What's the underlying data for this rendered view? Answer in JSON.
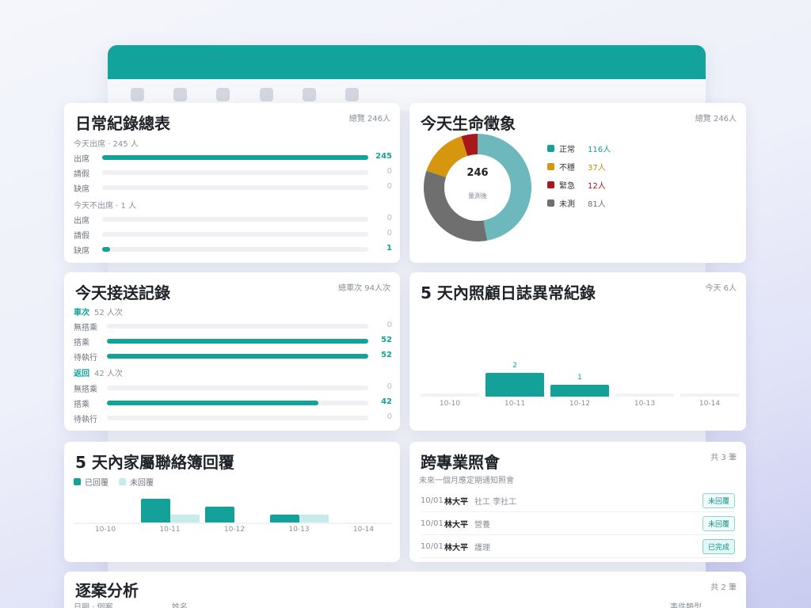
{
  "daily": {
    "title": "日常紀錄總表",
    "meta": "總覽 246人",
    "present_head": "今天出席 · 245 人",
    "present_rows": [
      {
        "label": "出席",
        "value": "245",
        "pct": 1.0
      },
      {
        "label": "請假",
        "value": "0",
        "pct": 0
      },
      {
        "label": "缺席",
        "value": "0",
        "pct": 0
      }
    ],
    "absent_head": "今天不出席 · 1 人",
    "absent_rows": [
      {
        "label": "出席",
        "value": "0",
        "pct": 0
      },
      {
        "label": "請假",
        "value": "0",
        "pct": 0
      },
      {
        "label": "缺席",
        "value": "1",
        "pct": 0.03
      }
    ]
  },
  "vitals": {
    "title": "今天生命徵象",
    "meta": "總覽 246人",
    "center_value": "246",
    "center_label": "量測後",
    "legend": [
      {
        "name": "正常",
        "value": "116人",
        "count": 116,
        "color": "#6cb8bd"
      },
      {
        "name": "不穩",
        "value": "37人",
        "count": 37,
        "color": "#d6960d"
      },
      {
        "name": "緊急",
        "value": "12人",
        "count": 12,
        "color": "#a8171a"
      },
      {
        "name": "未測",
        "value": "81人",
        "count": 81,
        "color": "#6f6f6f"
      }
    ],
    "legend_swatch_colors": [
      "#14a19a",
      "#d6960d",
      "#a8171a",
      "#6f6f6f"
    ],
    "legend_value_colors": [
      "#13a19a",
      "#c98a06",
      "#a8171a",
      "#6f6f6f"
    ]
  },
  "transport": {
    "title": "今天接送記錄",
    "meta": "總車次 94人次",
    "out_label": "車次",
    "out_count": "52 人次",
    "out_rows": [
      {
        "label": "無搭乘",
        "value": "0",
        "pct": 0
      },
      {
        "label": "搭乘",
        "value": "52",
        "pct": 1.0
      },
      {
        "label": "待執行",
        "value": "52",
        "pct": 1.0
      }
    ],
    "ret_label": "返回",
    "ret_count": "42 人次",
    "ret_rows": [
      {
        "label": "無搭乘",
        "value": "0",
        "pct": 0
      },
      {
        "label": "搭乘",
        "value": "42",
        "pct": 0.81
      },
      {
        "label": "待執行",
        "value": "0",
        "pct": 0
      }
    ]
  },
  "care_log": {
    "title": "5 天內照顧日誌異常紀錄",
    "meta": "今天 6人"
  },
  "family": {
    "title": "5 天內家屬聯絡簿回覆",
    "legend_replied": "已回覆",
    "legend_unreplied": "未回覆",
    "replied_color": "#14a19a",
    "unreplied_color": "#c6ebe8"
  },
  "meeting": {
    "title": "跨專業照會",
    "meta": "共 3 筆",
    "subtitle": "未來一個月應定期通知照會",
    "rows": [
      {
        "date": "10/01",
        "name": "林大平",
        "desc": "社工 李社工",
        "status": "未回覆"
      },
      {
        "date": "10/01",
        "name": "林大平",
        "desc": "營養",
        "status": "未回覆"
      },
      {
        "date": "10/01",
        "name": "林大平",
        "desc": "護理",
        "status": "已完成"
      }
    ]
  },
  "case": {
    "title": "逐案分析",
    "meta": "共 2 筆",
    "col_date": "日期 · 個案",
    "col_name": "姓名",
    "col_type": "事件類型"
  },
  "chart_data": [
    {
      "type": "pie",
      "categories": [
        "正常",
        "不穩",
        "緊急",
        "未測"
      ],
      "values": [
        116,
        37,
        12,
        81
      ]
    },
    {
      "type": "bar",
      "categories": [
        "10-10",
        "10-11",
        "10-12",
        "10-13",
        "10-14"
      ],
      "values": [
        0,
        2,
        1,
        0,
        0
      ]
    },
    {
      "type": "bar",
      "categories": [
        "10-10",
        "10-11",
        "10-12",
        "10-13",
        "10-14"
      ],
      "series": [
        {
          "name": "已回覆",
          "values": [
            0,
            3,
            2,
            1,
            0
          ]
        },
        {
          "name": "未回覆",
          "values": [
            0,
            1,
            0,
            1,
            0
          ]
        }
      ]
    }
  ]
}
